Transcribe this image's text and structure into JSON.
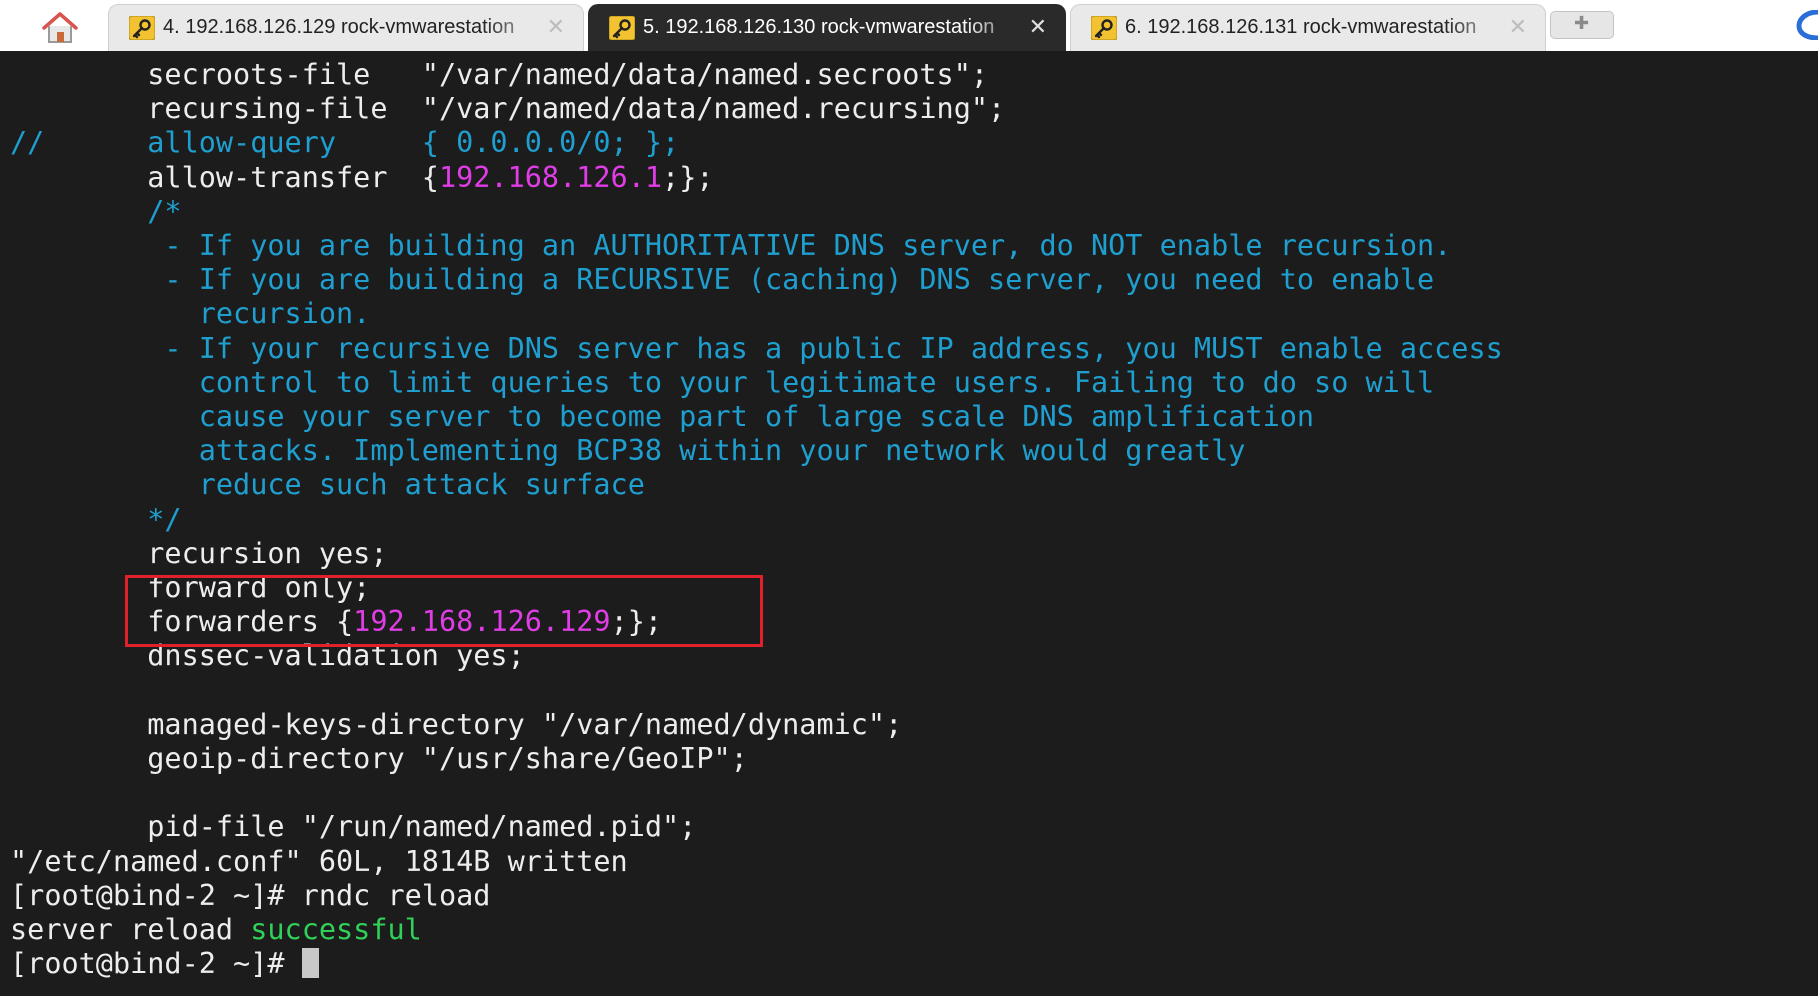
{
  "tabs": [
    {
      "label": "4. 192.168.126.129 rock-vmwarestation",
      "active": false
    },
    {
      "label": "5. 192.168.126.130 rock-vmwarestation",
      "active": true
    },
    {
      "label": "6. 192.168.126.131 rock-vmwarestation",
      "active": false
    }
  ],
  "icons": {
    "home": "home-icon",
    "key": "key-icon",
    "close": "close-icon",
    "new_tab": "plus-icon",
    "browser": "browser-icon"
  },
  "terminal": {
    "lines": [
      {
        "text": "        secroots-file   \"/var/named/data/named.secroots\";",
        "segments": [
          {
            "text": "        secroots-file   \"/var/named/data/named.secroots\";",
            "style": "plain"
          }
        ]
      },
      {
        "text": "        recursing-file  \"/var/named/data/named.recursing\";",
        "segments": [
          {
            "text": "        recursing-file  \"/var/named/data/named.recursing\";",
            "style": "plain"
          }
        ]
      },
      {
        "text": "//      allow-query     { 0.0.0.0/0; };",
        "segments": [
          {
            "text": "//      allow-query     { 0.0.0.0/0; };",
            "style": "comment"
          }
        ]
      },
      {
        "text": "        allow-transfer  {192.168.126.1;};",
        "segments": [
          {
            "text": "        allow-transfer  {",
            "style": "plain"
          },
          {
            "text": "192.168.126.1",
            "style": "ip"
          },
          {
            "text": ";};",
            "style": "plain"
          }
        ]
      },
      {
        "text": "        /*",
        "segments": [
          {
            "text": "        /*",
            "style": "comment"
          }
        ]
      },
      {
        "text": "         - If you are building an AUTHORITATIVE DNS server, do NOT enable recursion.",
        "segments": [
          {
            "text": "         - If you are building an AUTHORITATIVE DNS server, do NOT enable recursion.",
            "style": "comment"
          }
        ]
      },
      {
        "text": "         - If you are building a RECURSIVE (caching) DNS server, you need to enable",
        "segments": [
          {
            "text": "         - If you are building a RECURSIVE (caching) DNS server, you need to enable",
            "style": "comment"
          }
        ]
      },
      {
        "text": "           recursion.",
        "segments": [
          {
            "text": "           recursion.",
            "style": "comment"
          }
        ]
      },
      {
        "text": "         - If your recursive DNS server has a public IP address, you MUST enable access",
        "segments": [
          {
            "text": "         - If your recursive DNS server has a public IP address, you MUST enable access",
            "style": "comment"
          }
        ]
      },
      {
        "text": "           control to limit queries to your legitimate users. Failing to do so will",
        "segments": [
          {
            "text": "           control to limit queries to your legitimate users. Failing to do so will",
            "style": "comment"
          }
        ]
      },
      {
        "text": "           cause your server to become part of large scale DNS amplification",
        "segments": [
          {
            "text": "           cause your server to become part of large scale DNS amplification",
            "style": "comment"
          }
        ]
      },
      {
        "text": "           attacks. Implementing BCP38 within your network would greatly",
        "segments": [
          {
            "text": "           attacks. Implementing BCP38 within your network would greatly",
            "style": "comment"
          }
        ]
      },
      {
        "text": "           reduce such attack surface",
        "segments": [
          {
            "text": "           reduce such attack surface",
            "style": "comment"
          }
        ]
      },
      {
        "text": "        */",
        "segments": [
          {
            "text": "        */",
            "style": "comment"
          }
        ]
      },
      {
        "text": "        recursion yes;",
        "segments": [
          {
            "text": "        recursion yes;",
            "style": "plain"
          }
        ]
      },
      {
        "text": "        forward only;",
        "segments": [
          {
            "text": "        forward only;",
            "style": "plain"
          }
        ]
      },
      {
        "text": "        forwarders {192.168.126.129;};",
        "segments": [
          {
            "text": "        forwarders {",
            "style": "plain"
          },
          {
            "text": "192.168.126.129",
            "style": "ip"
          },
          {
            "text": ";};",
            "style": "plain"
          }
        ]
      },
      {
        "text": "        dnssec-validation yes;",
        "segments": [
          {
            "text": "        dnssec-validation yes;",
            "style": "plain"
          }
        ]
      },
      {
        "text": "",
        "segments": []
      },
      {
        "text": "        managed-keys-directory \"/var/named/dynamic\";",
        "segments": [
          {
            "text": "        managed-keys-directory \"/var/named/dynamic\";",
            "style": "plain"
          }
        ]
      },
      {
        "text": "        geoip-directory \"/usr/share/GeoIP\";",
        "segments": [
          {
            "text": "        geoip-directory \"/usr/share/GeoIP\";",
            "style": "plain"
          }
        ]
      },
      {
        "text": "",
        "segments": []
      },
      {
        "text": "        pid-file \"/run/named/named.pid\";",
        "segments": [
          {
            "text": "        pid-file \"/run/named/named.pid\";",
            "style": "plain"
          }
        ]
      },
      {
        "text": "\"/etc/named.conf\" 60L, 1814B written",
        "segments": [
          {
            "text": "\"/etc/named.conf\" 60L, 1814B written",
            "style": "plain"
          }
        ]
      },
      {
        "text": "[root@bind-2 ~]# rndc reload",
        "segments": [
          {
            "text": "[root@bind-2 ~]# rndc reload",
            "style": "plain"
          }
        ]
      },
      {
        "text": "server reload successful",
        "segments": [
          {
            "text": "server reload ",
            "style": "plain"
          },
          {
            "text": "successful",
            "style": "success"
          }
        ]
      },
      {
        "text": "[root@bind-2 ~]# ",
        "segments": [
          {
            "text": "[root@bind-2 ~]# ",
            "style": "plain"
          }
        ],
        "cursor": true
      }
    ]
  },
  "colors": {
    "background": "#1c1c1c",
    "text": "#ededed",
    "comment": "#1f9fcf",
    "ip": "#e03de6",
    "success": "#30d158",
    "highlight_border": "#e0202a",
    "active_tab": "#2a2a2a"
  }
}
